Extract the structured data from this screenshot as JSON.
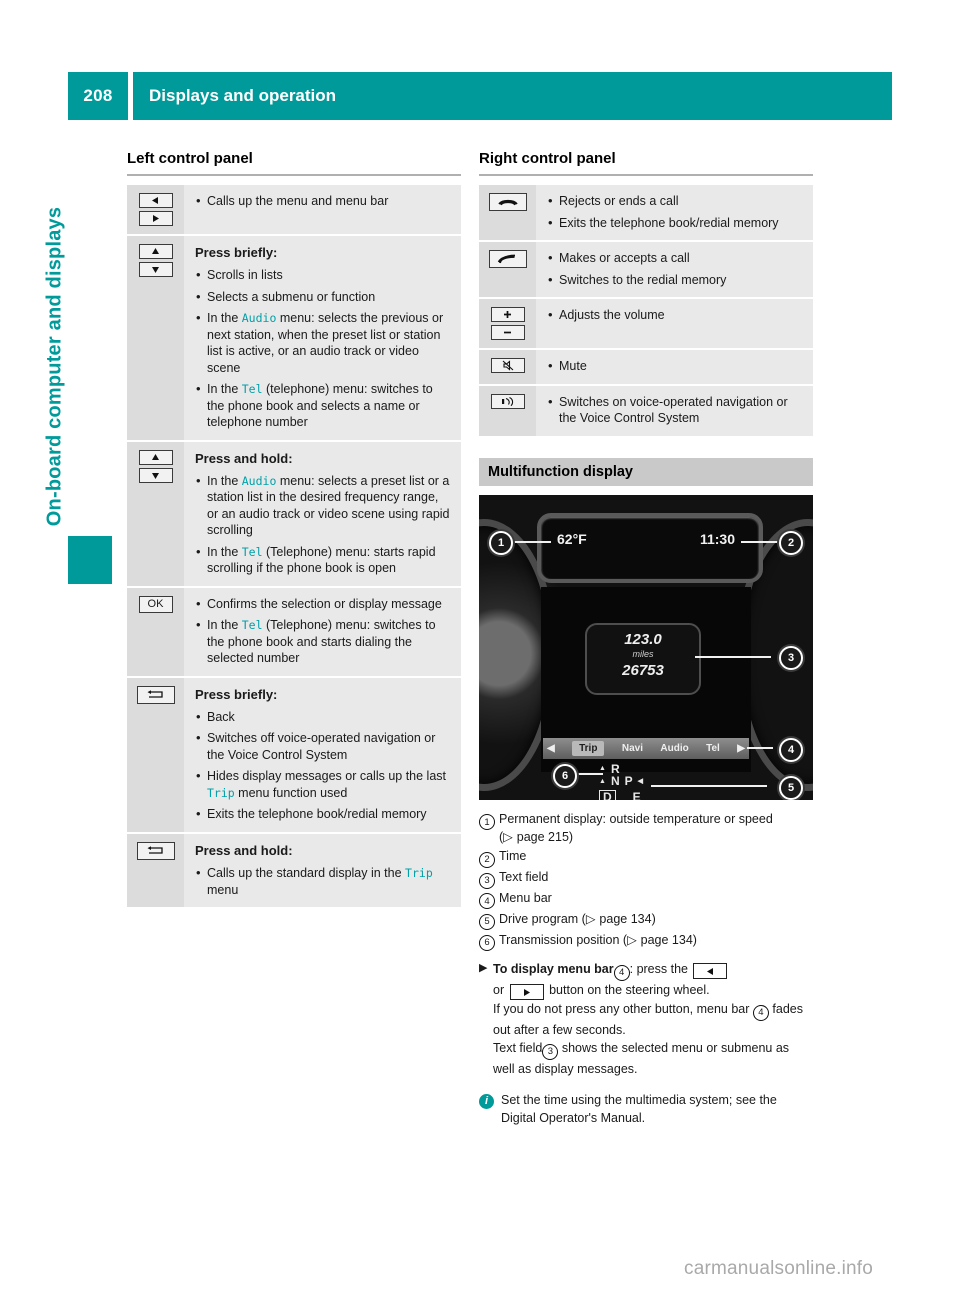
{
  "header": {
    "page_number": "208",
    "title": "Displays and operation",
    "accent_color": "#009a9a"
  },
  "chapter_tab": {
    "label": "On-board computer and displays"
  },
  "left_panel": {
    "title": "Left control panel",
    "rows": [
      {
        "icons": [
          "left-arrow-button",
          "right-arrow-button"
        ],
        "lead": "",
        "items": [
          "Calls up the menu and menu bar"
        ]
      },
      {
        "icons": [
          "up-arrow-button",
          "down-arrow-button"
        ],
        "lead": "Press briefly:",
        "items": [
          "Scrolls in lists",
          "Selects a submenu or function",
          "In the Audio menu: selects the previous or next station, when the preset list or station list is active, or an audio track or video scene",
          "In the Tel (telephone) menu: switches to the phone book and selects a name or telephone number"
        ]
      },
      {
        "icons": [
          "up-arrow-button",
          "down-arrow-button"
        ],
        "lead": "Press and hold:",
        "items": [
          "In the Audio menu: selects a preset list or a station list in the desired frequency range, or an audio track or video scene using rapid scrolling",
          "In the Tel (Telephone) menu: starts rapid scrolling if the phone book is open"
        ]
      },
      {
        "icons": [
          "ok-button"
        ],
        "lead": "",
        "items": [
          "Confirms the selection or display message",
          "In the Tel (Telephone) menu: switches to the phone book and starts dialing the selected number"
        ]
      },
      {
        "icons": [
          "back-button"
        ],
        "lead": "Press briefly:",
        "items": [
          "Back",
          "Switches off voice-operated navigation or the Voice Control System",
          "Hides display messages or calls up the last Trip menu function used",
          "Exits the telephone book/redial memory"
        ]
      },
      {
        "icons": [
          "back-button"
        ],
        "lead": "Press and hold:",
        "items": [
          "Calls up the standard display in the Trip menu"
        ]
      }
    ],
    "ok_label": "OK"
  },
  "right_panel": {
    "title": "Right control panel",
    "rows": [
      {
        "icons": [
          "end-call-button"
        ],
        "items": [
          "Rejects or ends a call",
          "Exits the telephone book/redial memory"
        ]
      },
      {
        "icons": [
          "accept-call-button"
        ],
        "items": [
          "Makes or accepts a call",
          "Switches to the redial memory"
        ]
      },
      {
        "icons": [
          "volume-up-button",
          "volume-down-button"
        ],
        "items": [
          "Adjusts the volume"
        ]
      },
      {
        "icons": [
          "mute-button"
        ],
        "items": [
          "Mute"
        ]
      },
      {
        "icons": [
          "voice-control-button"
        ],
        "items": [
          "Switches on voice-operated navigation or the Voice Control System"
        ]
      }
    ]
  },
  "multifunction": {
    "banner": "Multifunction display",
    "cluster": {
      "outside_temperature": "62°F",
      "time": "11:30",
      "trip_distance": "123.0",
      "trip_unit": "miles",
      "odometer": "26753",
      "menu_items": [
        "Trip",
        "Navi",
        "Audio",
        "Tel"
      ],
      "selected_menu": "Trip",
      "gear_positions": [
        "R",
        "N",
        "P",
        "D",
        "E"
      ],
      "selected_gear": "D",
      "callouts": [
        "1",
        "2",
        "3",
        "4",
        "5",
        "6"
      ]
    },
    "legend": [
      {
        "num": "1",
        "text": "Permanent display: outside temperature or speed (",
        "page_ref": "page 215",
        "tail": ")"
      },
      {
        "num": "2",
        "text": "Time",
        "page_ref": "",
        "tail": ""
      },
      {
        "num": "3",
        "text": "Text field",
        "page_ref": "",
        "tail": ""
      },
      {
        "num": "4",
        "text": "Menu bar",
        "page_ref": "",
        "tail": ""
      },
      {
        "num": "5",
        "text": "Drive program (",
        "page_ref": "page 134",
        "tail": ")"
      },
      {
        "num": "6",
        "text": "Transmission position (",
        "page_ref": "page 134",
        "tail": ")"
      }
    ],
    "instruction": {
      "lead": "To display menu bar",
      "lead_num": "4",
      "after_lead": ": press the",
      "or_word": "or",
      "after_buttons": "button on the steering wheel.",
      "line2": "If you do not press any other button, menu bar",
      "line2_num": "4",
      "line2_tail": "fades out after a few seconds.",
      "line3_head": "Text field",
      "line3_num": "3",
      "line3_tail": "shows the selected menu or submenu as well as display messages."
    },
    "note": "Set the time using the multimedia system; see the Digital Operator's Manual."
  },
  "footer": {
    "watermark": "carmanualsonline.info"
  }
}
